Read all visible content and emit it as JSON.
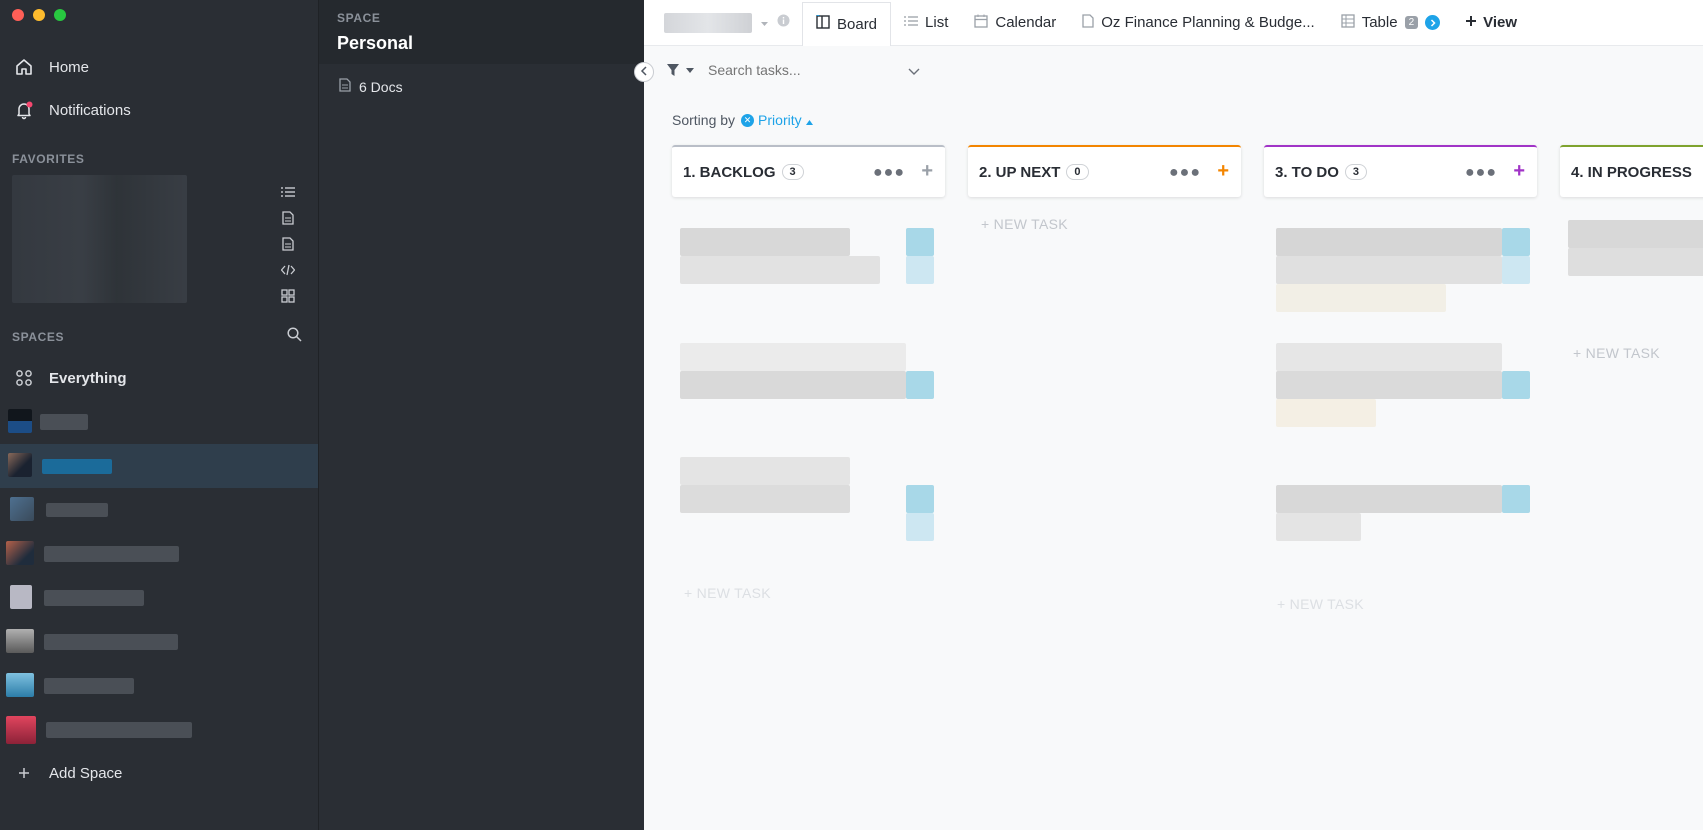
{
  "colors": {
    "accent": "#1ea3e8",
    "backlog": "#b9bec7",
    "upnext": "#f38500",
    "todo": "#a134c7",
    "inprogress": "#7fa32e",
    "notification_dot": "#f5476f"
  },
  "sidebar": {
    "home_label": "Home",
    "notifications_label": "Notifications",
    "favorites_label": "FAVORITES",
    "spaces_label": "SPACES",
    "everything_label": "Everything",
    "add_space_label": "Add Space"
  },
  "panel": {
    "space_label": "SPACE",
    "space_title": "Personal",
    "docs_label": "6 Docs"
  },
  "topbar": {
    "tabs": [
      {
        "label": "Board",
        "icon": "board-icon"
      },
      {
        "label": "List",
        "icon": "list-icon"
      },
      {
        "label": "Calendar",
        "icon": "calendar-icon"
      },
      {
        "label": "Oz Finance Planning & Budge...",
        "icon": "doc-icon"
      },
      {
        "label": "Table",
        "icon": "table-icon"
      }
    ],
    "table_badge": "2",
    "add_view_label": "View"
  },
  "search": {
    "placeholder": "Search tasks..."
  },
  "sorting": {
    "label": "Sorting by",
    "value": "Priority"
  },
  "columns": [
    {
      "title": "1. BACKLOG",
      "count": "3",
      "new_task": "+ NEW TASK"
    },
    {
      "title": "2. UP NEXT",
      "count": "0",
      "new_task": "+ NEW TASK"
    },
    {
      "title": "3. TO DO",
      "count": "3",
      "new_task": "+ NEW TASK"
    },
    {
      "title": "4. IN PROGRESS",
      "new_task": "+ NEW TASK"
    }
  ]
}
